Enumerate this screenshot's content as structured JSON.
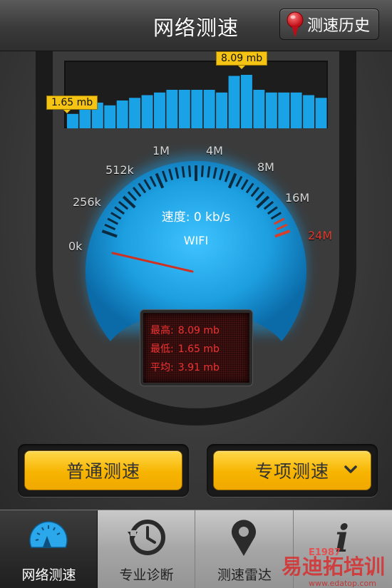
{
  "header": {
    "title": "网络测速",
    "history_button": "测速历史",
    "history_icon": "map-pin-icon"
  },
  "history_chart": {
    "max_tag": "8.09 mb",
    "min_tag": "1.65 mb",
    "bars_relative": [
      0.27,
      0.52,
      0.48,
      0.43,
      0.52,
      0.57,
      0.62,
      0.67,
      0.72,
      0.72,
      0.72,
      0.72,
      0.67,
      0.98,
      1.0,
      0.72,
      0.67,
      0.67,
      0.67,
      0.62,
      0.57
    ],
    "bar_color": "#19a3e6"
  },
  "gauge": {
    "scale_labels": [
      "0k",
      "256k",
      "512k",
      "1M",
      "4M",
      "8M",
      "16M",
      "24M"
    ],
    "speed_label": "速度: 0 kb/s",
    "network_label": "WIFI",
    "accent": "#1aa6e8",
    "needle_color": "#d03020"
  },
  "stats": {
    "max_label": "最高:",
    "max_value": "8.09 mb",
    "min_label": "最低:",
    "min_value": "1.65 mb",
    "avg_label": "平均:",
    "avg_value": "3.91 mb",
    "color": "#ef3333"
  },
  "buttons": {
    "normal": "普通测速",
    "special": "专项测速",
    "special_icon": "chevron-down-icon"
  },
  "tabs": [
    {
      "label": "网络测速",
      "icon": "speedometer-icon",
      "active": true
    },
    {
      "label": "专业诊断",
      "icon": "history-clock-icon",
      "active": false
    },
    {
      "label": "测速雷达",
      "icon": "location-pin-icon",
      "active": false
    },
    {
      "label": "i",
      "icon": "info-icon",
      "active": false
    }
  ],
  "watermark": {
    "text": "易迪拓培训",
    "sub": "E1987",
    "url": "www.edatop.com"
  }
}
